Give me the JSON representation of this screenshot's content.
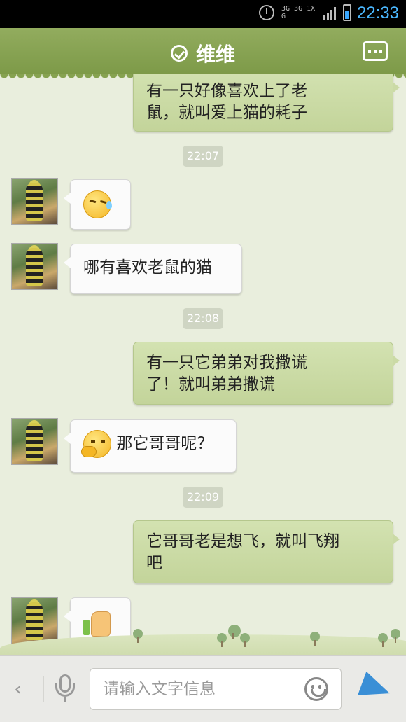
{
  "status_bar": {
    "network_text": "3G 3G 1X G",
    "clock": "22:33",
    "colors": {
      "clock": "#4bb8ff",
      "battery": "#3aa7ff"
    }
  },
  "header": {
    "title": "维维",
    "colors": {
      "background": "#86a250"
    }
  },
  "messages": [
    {
      "type": "outgoing",
      "text": "有一只好像喜欢上了老鼠，就叫爱上猫的耗子"
    },
    {
      "type": "time",
      "text": "22:07"
    },
    {
      "type": "incoming",
      "emoji": "sweat-face-emoji"
    },
    {
      "type": "incoming",
      "text": "哪有喜欢老鼠的猫"
    },
    {
      "type": "time",
      "text": "22:08"
    },
    {
      "type": "outgoing",
      "text": "有一只它弟弟对我撒谎了！就叫弟弟撒谎"
    },
    {
      "type": "time",
      "text": "22:08"
    },
    {
      "type": "incoming",
      "emoji": "thinking-face-emoji",
      "text": "那它哥哥呢？"
    },
    {
      "type": "time",
      "text": "22:09"
    },
    {
      "type": "outgoing",
      "text": "它哥哥老是想飞，就叫飞翔吧"
    },
    {
      "type": "incoming",
      "emoji": "thumbs-up-emoji"
    }
  ],
  "chat": {
    "m1_line1": "有一只好像喜欢上了老",
    "m1_line2": "鼠，就叫爱上猫的耗子",
    "t1": "22:07",
    "m3": "哪有喜欢老鼠的猫",
    "t2": "22:08",
    "m4_line1": "有一只它弟弟对我撒谎",
    "m4_line2": "了！就叫弟弟撒谎",
    "m5": "那它哥哥呢？",
    "t3": "22:09",
    "m6_line1": "它哥哥老是想飞，就叫飞翔",
    "m6_line2": "吧"
  },
  "input_bar": {
    "back_glyph": "‹",
    "placeholder": "请输入文字信息",
    "value": ""
  }
}
